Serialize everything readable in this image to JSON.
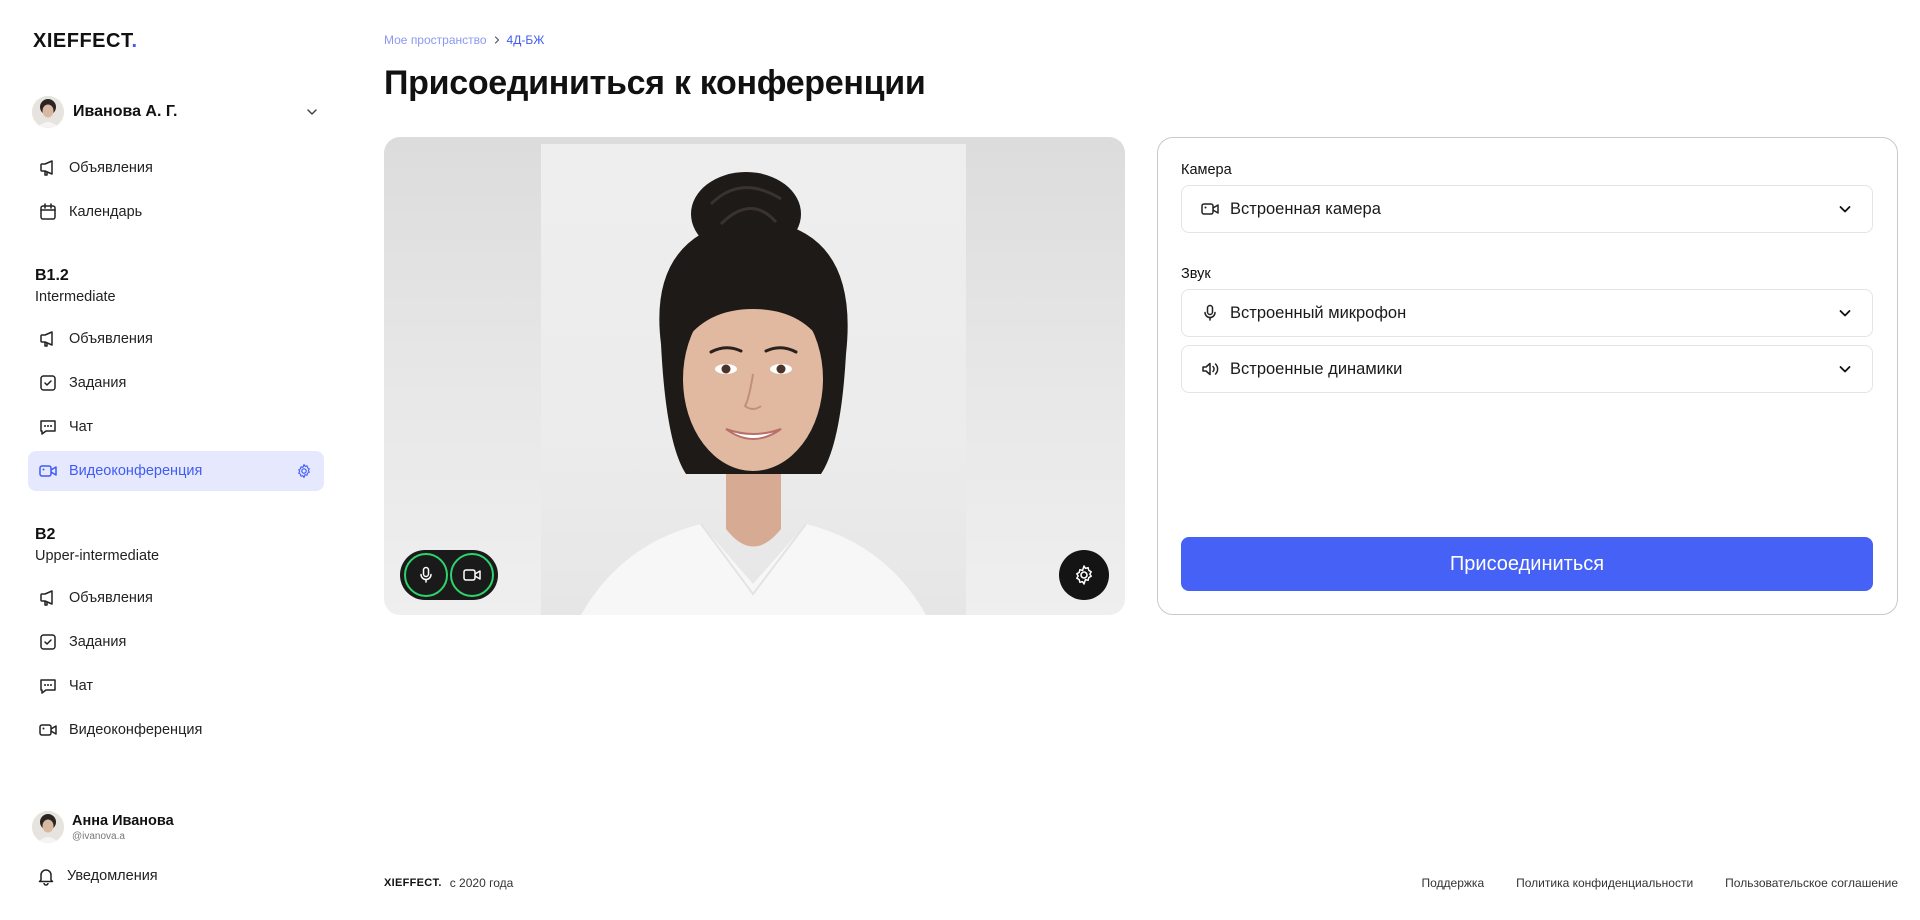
{
  "brand": {
    "logo": "XIEFFECT",
    "logo_dot": ".",
    "accent": "#3f5bf6"
  },
  "user": {
    "name": "Иванова А. Г."
  },
  "nav_top": [
    {
      "label": "Объявления",
      "icon": "megaphone-icon"
    },
    {
      "label": "Календарь",
      "icon": "calendar-icon"
    }
  ],
  "groups": [
    {
      "title": "B1.2",
      "subtitle": "Intermediate",
      "items": [
        {
          "label": "Объявления",
          "icon": "megaphone-icon"
        },
        {
          "label": "Задания",
          "icon": "checkbox-icon"
        },
        {
          "label": "Чат",
          "icon": "chat-icon"
        },
        {
          "label": "Видеоконференция",
          "icon": "video-icon",
          "active": true
        }
      ]
    },
    {
      "title": "B2",
      "subtitle": "Upper-intermediate",
      "items": [
        {
          "label": "Объявления",
          "icon": "megaphone-icon"
        },
        {
          "label": "Задания",
          "icon": "checkbox-icon"
        },
        {
          "label": "Чат",
          "icon": "chat-icon"
        },
        {
          "label": "Видеоконференция",
          "icon": "video-icon"
        }
      ]
    }
  ],
  "profile": {
    "name": "Анна Иванова",
    "handle": "@ivanova.a"
  },
  "notifications": {
    "label": "Уведомления"
  },
  "breadcrumb": {
    "root": "Мое пространство",
    "current": "4Д-БЖ"
  },
  "page_title": "Присоединиться к конференции",
  "settings": {
    "camera_label": "Камера",
    "camera_value": "Встроенная камера",
    "sound_label": "Звук",
    "mic_value": "Встроенный микрофон",
    "speaker_value": "Встроенные динамики",
    "join_label": "Присоединиться"
  },
  "footer": {
    "logo": "XIEFFECT.",
    "copy": "с 2020 года",
    "links": [
      "Поддержка",
      "Политика конфиденциальности",
      "Пользовательское соглашение"
    ]
  }
}
